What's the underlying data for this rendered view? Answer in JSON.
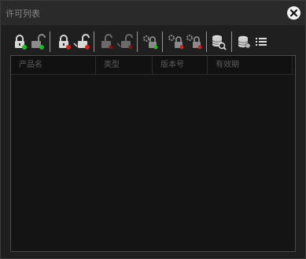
{
  "window": {
    "title": "许可列表",
    "close_icon": "close-circle-icon"
  },
  "toolbar": {
    "buttons": [
      {
        "name": "lock-green-icon"
      },
      {
        "name": "unlock-green-icon"
      },
      {
        "name": "lock-red-icon"
      },
      {
        "name": "unlock-red-icon"
      },
      {
        "name": "lock-disabled-icon"
      },
      {
        "name": "unlock-disabled-icon"
      },
      {
        "name": "lock-settings-icon"
      },
      {
        "name": "lock-settings-multi-icon"
      },
      {
        "name": "lock-settings-multi-2-icon"
      },
      {
        "name": "database-search-icon"
      },
      {
        "name": "database-icon"
      },
      {
        "name": "list-icon"
      }
    ]
  },
  "table": {
    "columns": [
      "产品名",
      "类型",
      "版本号",
      "有效期"
    ]
  },
  "colors": {
    "background": "#1f1f1f",
    "status_green": "#1cc01c",
    "status_red": "#d22020"
  }
}
